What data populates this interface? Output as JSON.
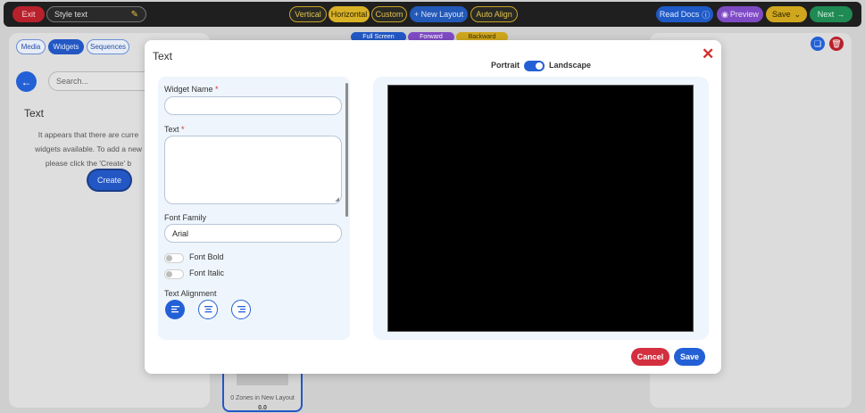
{
  "topbar": {
    "exit_label": "Exit",
    "style_name": "Style text",
    "layout_vertical": "Vertical",
    "layout_horizontal": "Horizontal",
    "layout_custom": "Custom",
    "new_layout": "+ New Layout",
    "auto_align": "Auto Align",
    "read_docs": "Read Docs",
    "preview": "Preview",
    "save": "Save",
    "next": "Next"
  },
  "background": {
    "tabs": [
      "Media",
      "Widgets",
      "Sequences"
    ],
    "search_placeholder": "Search...",
    "section_title": "Text",
    "message_lines": [
      "It appears that there are curre",
      "widgets available. To add a new",
      "please click the 'Create' b"
    ],
    "create_label": "Create",
    "tools": [
      "Full Screen",
      "Forward",
      "Backward"
    ],
    "zone_text": "0 Zones in New Layout",
    "zone_value": "0.0"
  },
  "modal": {
    "title": "Text",
    "widget_name_label": "Widget Name",
    "widget_name_value": "",
    "text_label": "Text",
    "required_mark": "*",
    "font_family_label": "Font Family",
    "font_family_value": "Arial",
    "font_bold_label": "Font Bold",
    "font_italic_label": "Font Italic",
    "text_alignment_label": "Text Alignment",
    "orientation_portrait": "Portrait",
    "orientation_landscape": "Landscape",
    "cancel_label": "Cancel",
    "save_label": "Save"
  },
  "colors": {
    "primary": "#2360d6",
    "danger": "#d32f3f",
    "topbar": "#1f1f1f"
  }
}
